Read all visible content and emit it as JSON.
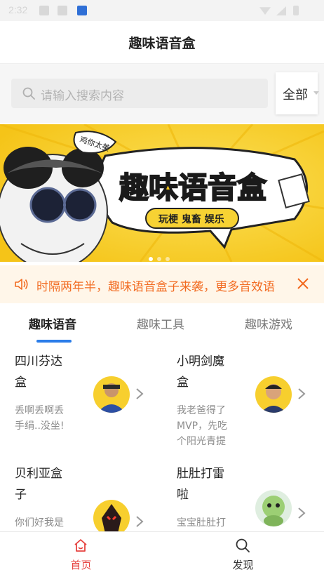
{
  "status_bar": {
    "time": "2:32"
  },
  "app_bar": {
    "title": "趣味语音盒"
  },
  "search": {
    "placeholder": "请输入搜索内容",
    "filter_label": "全部"
  },
  "banner": {
    "title": "趣味语音盒",
    "tags": "玩梗 鬼畜 娱乐",
    "bubble": "鸡你太美",
    "slides": 3,
    "active_slide": 0
  },
  "notice": {
    "text": "时隔两年半，趣味语音盒子来袭，更多音效语"
  },
  "tabs": [
    {
      "label": "趣味语音",
      "active": true
    },
    {
      "label": "趣味工具",
      "active": false
    },
    {
      "label": "趣味游戏",
      "active": false
    }
  ],
  "cards": [
    {
      "name": "四川芬达盒",
      "desc": "丢啊丢啊丢手绢..没坐!"
    },
    {
      "name": "小明剑魔盒",
      "desc": "我老爸得了MVP，先吃个阳光青提"
    },
    {
      "name": "贝利亚盒子",
      "desc": "你们好我是"
    },
    {
      "name": "肚肚打雷啦",
      "desc": "宝宝肚肚打"
    }
  ],
  "bottom_nav": [
    {
      "label": "首页",
      "active": true
    },
    {
      "label": "发现",
      "active": false
    }
  ],
  "colors": {
    "accent_red": "#e64340",
    "notice_orange": "#f26b21",
    "tab_indicator": "#2b7de9",
    "banner_yellow": "#f7d233"
  }
}
